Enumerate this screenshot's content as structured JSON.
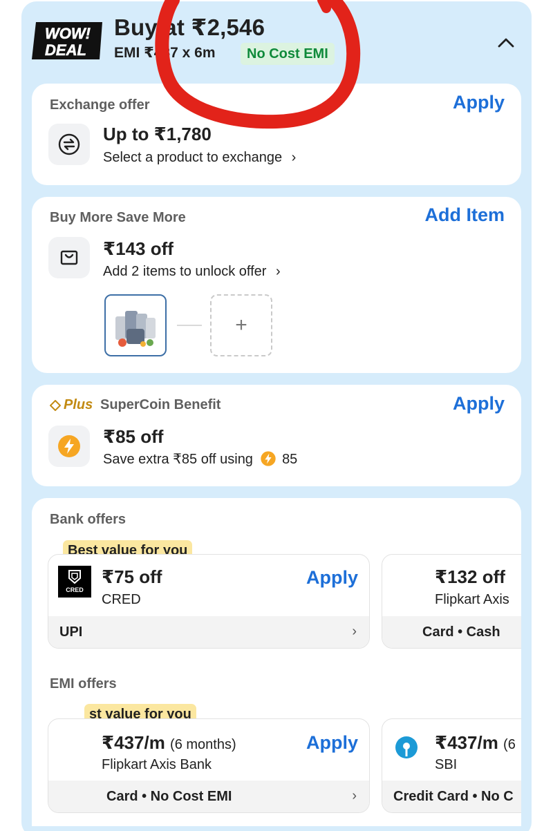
{
  "header": {
    "logo_line1": "WOW!",
    "logo_line2": "DEAL",
    "buy_at": "Buy at ₹2,546",
    "emi_text": "EMI ₹437 x 6m",
    "no_cost_emi": "No Cost EMI",
    "collapse_icon": "chevron-up-icon"
  },
  "exchange": {
    "title": "Exchange offer",
    "action": "Apply",
    "amount": "Up to ₹1,780",
    "subtitle": "Select a product to exchange",
    "icon": "exchange-arrows-icon"
  },
  "buy_more": {
    "title": "Buy More Save More",
    "action": "Add Item",
    "amount": "₹143 off",
    "subtitle": "Add 2 items to unlock offer",
    "icon": "bag-icon",
    "add_symbol": "+"
  },
  "supercoin": {
    "plus_label": "Plus",
    "title": "SuperCoin Benefit",
    "action": "Apply",
    "amount": "₹85 off",
    "subtitle": "Save extra ₹85 off using",
    "coins": "85",
    "icon": "supercoin-icon"
  },
  "bank_offers": {
    "title": "Bank offers",
    "best_badge": "Best value for you",
    "offers": [
      {
        "amount": "₹75 off",
        "bank": "CRED",
        "action": "Apply",
        "footer": "UPI",
        "logo_text": "CRED"
      },
      {
        "amount": "₹132 off",
        "bank": "Flipkart Axis",
        "footer": "Card • Cash"
      }
    ]
  },
  "emi_offers": {
    "title": "EMI offers",
    "best_badge": "st value for you",
    "offers": [
      {
        "amount": "₹437/m",
        "months": "(6 months)",
        "bank": "Flipkart Axis Bank",
        "action": "Apply",
        "footer": "Card • No Cost EMI"
      },
      {
        "amount": "₹437/m",
        "months": "(6",
        "bank": "SBI",
        "footer": "Credit Card • No C"
      }
    ]
  },
  "colors": {
    "panel_bg": "#d6ecfb",
    "accent_blue": "#1d6fd8",
    "no_cost_green": "#0f8a3a",
    "best_badge_yellow": "#fbe7a0",
    "annotation_red": "#e2231a"
  }
}
